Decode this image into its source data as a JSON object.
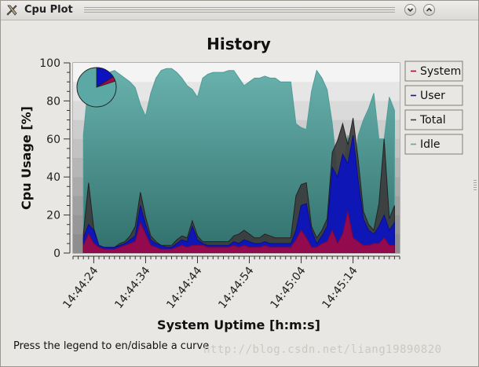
{
  "window": {
    "title": "Cpu Plot",
    "icon": "tools-icon",
    "buttons": [
      "minimize",
      "maximize"
    ]
  },
  "status": {
    "text": "Press the legend to en/disable a curve"
  },
  "watermark": {
    "text": "http://blog.csdn.net/liang19890820"
  },
  "colors": {
    "system": "#a00a45",
    "user": "#0c12c0",
    "total": "#3b3b3b",
    "idle": "#5ca8a4"
  },
  "chart_data": {
    "type": "area",
    "title": "History",
    "xlabel": "System Uptime [h:m:s]",
    "ylabel": "Cpu Usage [%]",
    "ylim": [
      0,
      100
    ],
    "yticks": [
      0,
      20,
      40,
      60,
      80,
      100
    ],
    "xlim": [
      "14:44:20",
      "14:45:23"
    ],
    "xticks": [
      "14:44:24",
      "14:44:34",
      "14:44:44",
      "14:44:54",
      "14:45:04",
      "14:45:14"
    ],
    "legend": [
      "System",
      "User",
      "Total",
      "Idle"
    ],
    "legend_position": "right",
    "grid": false,
    "x": [
      "14:44:22",
      "14:44:23",
      "14:44:24",
      "14:44:25",
      "14:44:26",
      "14:44:27",
      "14:44:28",
      "14:44:29",
      "14:44:30",
      "14:44:31",
      "14:44:32",
      "14:44:33",
      "14:44:34",
      "14:44:35",
      "14:44:36",
      "14:44:37",
      "14:44:38",
      "14:44:39",
      "14:44:40",
      "14:44:41",
      "14:44:42",
      "14:44:43",
      "14:44:44",
      "14:44:45",
      "14:44:46",
      "14:44:47",
      "14:44:48",
      "14:44:49",
      "14:44:50",
      "14:44:51",
      "14:44:52",
      "14:44:53",
      "14:44:54",
      "14:44:55",
      "14:44:56",
      "14:44:57",
      "14:44:58",
      "14:44:59",
      "14:45:00",
      "14:45:01",
      "14:45:02",
      "14:45:03",
      "14:45:04",
      "14:45:05",
      "14:45:06",
      "14:45:07",
      "14:45:08",
      "14:45:09",
      "14:45:10",
      "14:45:11",
      "14:45:12",
      "14:45:13",
      "14:45:14",
      "14:45:15",
      "14:45:16",
      "14:45:17",
      "14:45:18",
      "14:45:19",
      "14:45:20",
      "14:45:21",
      "14:45:22"
    ],
    "series": [
      {
        "name": "System",
        "values": [
          4,
          10,
          5,
          3,
          2,
          2,
          2,
          3,
          4,
          5,
          6,
          16,
          10,
          4,
          3,
          2,
          2,
          2,
          3,
          4,
          3,
          4,
          4,
          4,
          3,
          3,
          3,
          3,
          3,
          4,
          3,
          4,
          3,
          3,
          3,
          4,
          3,
          3,
          3,
          3,
          3,
          7,
          12,
          8,
          3,
          3,
          5,
          6,
          12,
          5,
          10,
          22,
          8,
          6,
          4,
          4,
          5,
          5,
          8,
          4,
          4
        ]
      },
      {
        "name": "User",
        "values": [
          8,
          15,
          12,
          4,
          3,
          3,
          3,
          4,
          5,
          7,
          9,
          25,
          15,
          7,
          5,
          4,
          3,
          3,
          5,
          7,
          6,
          14,
          7,
          5,
          4,
          4,
          4,
          4,
          4,
          6,
          5,
          7,
          6,
          5,
          5,
          6,
          5,
          5,
          5,
          5,
          5,
          12,
          25,
          26,
          12,
          5,
          9,
          14,
          45,
          40,
          52,
          47,
          62,
          38,
          18,
          12,
          10,
          14,
          20,
          12,
          16
        ]
      },
      {
        "name": "Total",
        "values": [
          10,
          37,
          13,
          4,
          3,
          3,
          3,
          5,
          6,
          9,
          14,
          32,
          19,
          9,
          6,
          4,
          4,
          4,
          7,
          9,
          8,
          17,
          9,
          6,
          6,
          6,
          6,
          6,
          6,
          9,
          10,
          12,
          10,
          8,
          8,
          10,
          9,
          8,
          8,
          8,
          8,
          30,
          36,
          37,
          14,
          8,
          12,
          18,
          53,
          59,
          68,
          57,
          71,
          49,
          22,
          15,
          12,
          26,
          60,
          18,
          25
        ]
      },
      {
        "name": "Idle",
        "values": [
          62,
          90,
          94,
          95,
          95,
          95,
          96,
          94,
          92,
          90,
          87,
          78,
          72,
          84,
          92,
          96,
          97,
          97,
          95,
          92,
          88,
          86,
          82,
          92,
          94,
          95,
          95,
          95,
          96,
          96,
          92,
          88,
          90,
          92,
          92,
          93,
          92,
          92,
          90,
          90,
          90,
          68,
          66,
          65,
          85,
          96,
          92,
          86,
          68,
          42,
          43,
          62,
          40,
          62,
          70,
          76,
          84,
          60,
          60,
          82,
          75
        ]
      }
    ]
  }
}
